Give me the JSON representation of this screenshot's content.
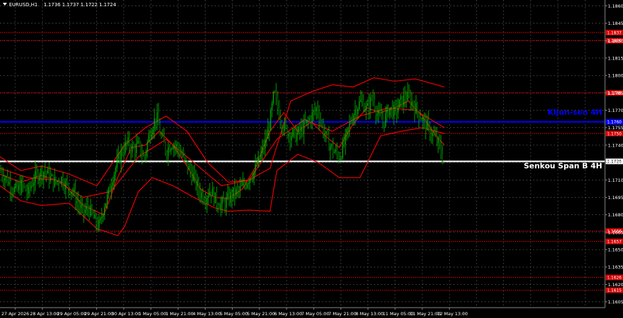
{
  "header": {
    "symbol": "EURUSD,H1",
    "ohlc": "1.1736 1.1737 1.1722 1.1724"
  },
  "colors": {
    "background": "#000000",
    "grid": "#5a5a5a",
    "bull_candle": "#00c800",
    "bear_candle": "#00c800",
    "ichimoku_lines": "#ff0000",
    "kijun": "#0000ff",
    "senkou": "#ffffff",
    "level_lines": "#d40000",
    "level_tag_bg": "#d40000",
    "axis_text": "#ffffff"
  },
  "chart_data": {
    "type": "candlestick",
    "y_axis_ticks": [
      "1.1860",
      "1.1845",
      "1.1830",
      "1.1815",
      "1.1800",
      "1.1785",
      "1.1770",
      "1.1755",
      "1.1740",
      "1.1725",
      "1.1710",
      "1.1695",
      "1.1680",
      "1.1665",
      "1.1650",
      "1.1635",
      "1.1620",
      "1.1605"
    ],
    "ylim": [
      1.16,
      1.1865
    ],
    "x_axis_ticks": [
      "27 Apr 2026",
      "28 Apr 13:00",
      "29 Apr 05:00",
      "29 Apr 21:00",
      "30 Apr 13:00",
      "1 May 05:00",
      "1 May 21:00",
      "4 May 13:00",
      "5 May 05:00",
      "5 May 21:00",
      "6 May 13:00",
      "7 May 05:00",
      "7 May 21:00",
      "8 May 13:00",
      "11 May 05:00",
      "11 May 21:00",
      "12 May 13:00"
    ],
    "horizontal_levels": [
      {
        "price": 1.1837,
        "label": "1.1837",
        "style": "dotted",
        "color": "#d40000"
      },
      {
        "price": 1.183,
        "label": "1.1830",
        "style": "dotted",
        "color": "#d40000"
      },
      {
        "price": 1.1785,
        "label": "1.1785",
        "style": "dotted",
        "color": "#d40000"
      },
      {
        "price": 1.176,
        "label": "1.1760",
        "style": "solid",
        "color": "#0000ff"
      },
      {
        "price": 1.175,
        "label": "1.1750",
        "style": "dotted",
        "color": "#d40000"
      },
      {
        "price": 1.1726,
        "label": "1.1726",
        "style": "solid",
        "color": "#ffffff"
      },
      {
        "price": 1.1666,
        "label": "1.1666",
        "style": "dotted",
        "color": "#d40000"
      },
      {
        "price": 1.1657,
        "label": "1.1657",
        "style": "dotted",
        "color": "#d40000"
      },
      {
        "price": 1.1626,
        "label": "1.1626",
        "style": "dotted",
        "color": "#d40000"
      },
      {
        "price": 1.1615,
        "label": "1.1615",
        "style": "dotted",
        "color": "#d40000"
      }
    ],
    "annotations": [
      {
        "text": "Kijun-sen 4H",
        "price": 1.1766,
        "color": "#0000ff"
      },
      {
        "text": "Senkou Span B 4H",
        "price": 1.172,
        "color": "#ffffff"
      }
    ],
    "price_path": [
      [
        0,
        1.1718
      ],
      [
        8,
        1.1712
      ],
      [
        16,
        1.1705
      ],
      [
        24,
        1.17
      ],
      [
        32,
        1.1706
      ],
      [
        40,
        1.1698
      ],
      [
        48,
        1.171
      ],
      [
        56,
        1.1716
      ],
      [
        64,
        1.1718
      ],
      [
        72,
        1.1712
      ],
      [
        80,
        1.1708
      ],
      [
        88,
        1.1712
      ],
      [
        96,
        1.1705
      ],
      [
        104,
        1.1702
      ],
      [
        112,
        1.169
      ],
      [
        120,
        1.1682
      ],
      [
        128,
        1.1686
      ],
      [
        136,
        1.1675
      ],
      [
        144,
        1.167
      ],
      [
        150,
        1.1688
      ],
      [
        156,
        1.1696
      ],
      [
        162,
        1.1712
      ],
      [
        168,
        1.1722
      ],
      [
        176,
        1.1735
      ],
      [
        184,
        1.1742
      ],
      [
        192,
        1.1736
      ],
      [
        200,
        1.174
      ],
      [
        208,
        1.1728
      ],
      [
        214,
        1.1745
      ],
      [
        220,
        1.1757
      ],
      [
        226,
        1.1765
      ],
      [
        232,
        1.1748
      ],
      [
        240,
        1.1735
      ],
      [
        248,
        1.1742
      ],
      [
        256,
        1.1738
      ],
      [
        264,
        1.173
      ],
      [
        272,
        1.172
      ],
      [
        280,
        1.1712
      ],
      [
        288,
        1.17
      ],
      [
        296,
        1.1695
      ],
      [
        304,
        1.1702
      ],
      [
        312,
        1.1692
      ],
      [
        320,
        1.1688
      ],
      [
        328,
        1.1692
      ],
      [
        336,
        1.1698
      ],
      [
        344,
        1.17
      ],
      [
        352,
        1.1705
      ],
      [
        360,
        1.1712
      ],
      [
        368,
        1.1718
      ],
      [
        376,
        1.173
      ],
      [
        384,
        1.1744
      ],
      [
        390,
        1.176
      ],
      [
        396,
        1.1785
      ],
      [
        402,
        1.177
      ],
      [
        410,
        1.1755
      ],
      [
        418,
        1.175
      ],
      [
        426,
        1.1748
      ],
      [
        434,
        1.1752
      ],
      [
        442,
        1.1758
      ],
      [
        450,
        1.1765
      ],
      [
        458,
        1.1772
      ],
      [
        466,
        1.1755
      ],
      [
        474,
        1.1742
      ],
      [
        482,
        1.1735
      ],
      [
        490,
        1.173
      ],
      [
        498,
        1.1742
      ],
      [
        506,
        1.176
      ],
      [
        514,
        1.1772
      ],
      [
        522,
        1.1778
      ],
      [
        530,
        1.177
      ],
      [
        538,
        1.1782
      ],
      [
        546,
        1.1765
      ],
      [
        554,
        1.176
      ],
      [
        562,
        1.1772
      ],
      [
        570,
        1.1768
      ],
      [
        578,
        1.1776
      ],
      [
        586,
        1.1782
      ],
      [
        594,
        1.1778
      ],
      [
        602,
        1.177
      ],
      [
        610,
        1.1762
      ],
      [
        618,
        1.1755
      ],
      [
        626,
        1.1748
      ],
      [
        634,
        1.174
      ],
      [
        642,
        1.1724
      ]
    ],
    "tenkan": [
      [
        0,
        1.1715
      ],
      [
        30,
        1.1708
      ],
      [
        60,
        1.1714
      ],
      [
        90,
        1.1708
      ],
      [
        120,
        1.1688
      ],
      [
        150,
        1.168
      ],
      [
        170,
        1.1712
      ],
      [
        190,
        1.1738
      ],
      [
        210,
        1.174
      ],
      [
        230,
        1.1752
      ],
      [
        250,
        1.174
      ],
      [
        270,
        1.1722
      ],
      [
        290,
        1.1702
      ],
      [
        310,
        1.1695
      ],
      [
        330,
        1.1694
      ],
      [
        350,
        1.1702
      ],
      [
        370,
        1.1722
      ],
      [
        390,
        1.1752
      ],
      [
        410,
        1.1768
      ],
      [
        430,
        1.1752
      ],
      [
        450,
        1.176
      ],
      [
        470,
        1.1748
      ],
      [
        490,
        1.1738
      ],
      [
        510,
        1.1758
      ],
      [
        530,
        1.1772
      ],
      [
        550,
        1.1768
      ],
      [
        570,
        1.1772
      ],
      [
        590,
        1.1778
      ],
      [
        610,
        1.1765
      ],
      [
        630,
        1.1748
      ],
      [
        642,
        1.174
      ]
    ],
    "kijun_line": [
      [
        0,
        1.172
      ],
      [
        40,
        1.1712
      ],
      [
        80,
        1.171
      ],
      [
        120,
        1.1695
      ],
      [
        160,
        1.17
      ],
      [
        200,
        1.173
      ],
      [
        240,
        1.1745
      ],
      [
        280,
        1.1725
      ],
      [
        320,
        1.1705
      ],
      [
        360,
        1.171
      ],
      [
        400,
        1.1745
      ],
      [
        440,
        1.1762
      ],
      [
        480,
        1.1752
      ],
      [
        520,
        1.1765
      ],
      [
        560,
        1.1772
      ],
      [
        600,
        1.177
      ],
      [
        642,
        1.1755
      ]
    ],
    "span_a": [
      [
        0,
        1.173
      ],
      [
        30,
        1.1718
      ],
      [
        60,
        1.1722
      ],
      [
        100,
        1.1715
      ],
      [
        140,
        1.1705
      ],
      [
        180,
        1.174
      ],
      [
        210,
        1.1755
      ],
      [
        240,
        1.1765
      ],
      [
        270,
        1.1752
      ],
      [
        300,
        1.1725
      ],
      [
        330,
        1.1708
      ],
      [
        360,
        1.171
      ],
      [
        390,
        1.172
      ],
      [
        420,
        1.1778
      ],
      [
        450,
        1.1786
      ],
      [
        480,
        1.1792
      ],
      [
        510,
        1.179
      ],
      [
        540,
        1.1798
      ],
      [
        570,
        1.1795
      ],
      [
        600,
        1.1797
      ],
      [
        642,
        1.179
      ]
    ],
    "span_b": [
      [
        0,
        1.1705
      ],
      [
        30,
        1.1692
      ],
      [
        60,
        1.1688
      ],
      [
        100,
        1.169
      ],
      [
        140,
        1.1668
      ],
      [
        170,
        1.1662
      ],
      [
        180,
        1.167
      ],
      [
        200,
        1.17
      ],
      [
        220,
        1.1712
      ],
      [
        250,
        1.1705
      ],
      [
        280,
        1.1695
      ],
      [
        310,
        1.1686
      ],
      [
        330,
        1.1683
      ],
      [
        360,
        1.1684
      ],
      [
        390,
        1.1683
      ],
      [
        400,
        1.1718
      ],
      [
        430,
        1.1732
      ],
      [
        460,
        1.1725
      ],
      [
        490,
        1.1712
      ],
      [
        520,
        1.1712
      ],
      [
        550,
        1.1748
      ],
      [
        580,
        1.1752
      ],
      [
        610,
        1.1755
      ],
      [
        642,
        1.175
      ]
    ]
  }
}
